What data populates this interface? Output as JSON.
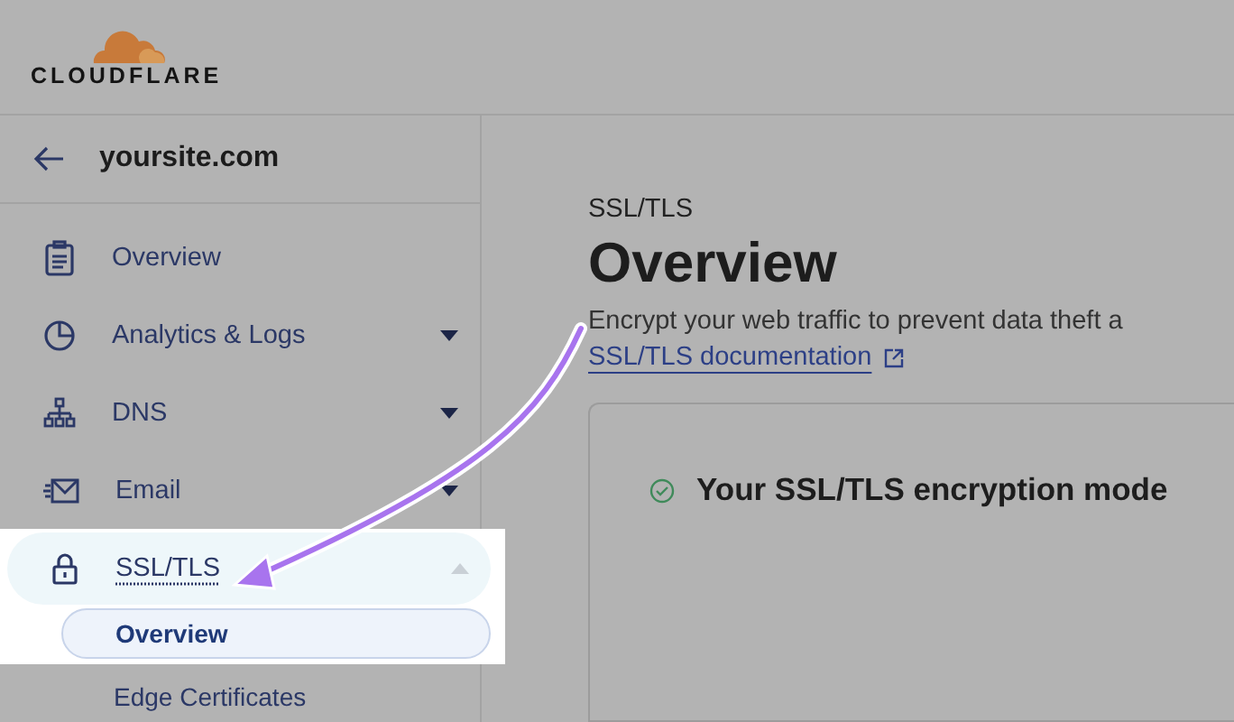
{
  "logo": {
    "wordmark": "CLOUDFLARE"
  },
  "sidebar": {
    "site": "yoursite.com",
    "items": [
      {
        "label": "Overview",
        "kind": "link",
        "selected": false
      },
      {
        "label": "Analytics & Logs",
        "kind": "group",
        "expanded": false,
        "selected": false
      },
      {
        "label": "DNS",
        "kind": "group",
        "expanded": false,
        "selected": false
      },
      {
        "label": "Email",
        "kind": "group",
        "expanded": false,
        "selected": false
      },
      {
        "label": "SSL/TLS",
        "kind": "group",
        "expanded": true,
        "selected": true,
        "children": [
          {
            "label": "Overview",
            "selected": true
          },
          {
            "label": "Edge Certificates",
            "selected": false
          }
        ]
      }
    ]
  },
  "page": {
    "section": "SSL/TLS",
    "title": "Overview",
    "description": "Encrypt your web traffic to prevent data theft a",
    "link": "SSL/TLS documentation",
    "card": {
      "title": "Your SSL/TLS encryption mode",
      "verified": true
    }
  }
}
